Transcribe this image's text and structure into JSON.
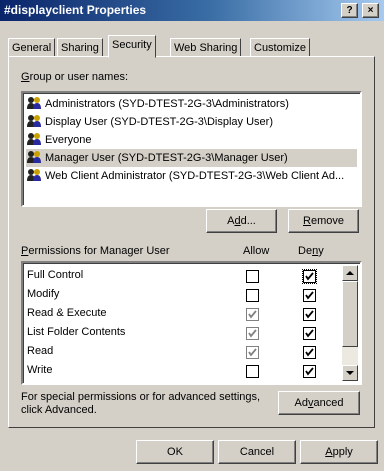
{
  "window": {
    "title": "#displayclient Properties",
    "help_label": "?",
    "close_label": "×"
  },
  "tabs": [
    {
      "label": "General"
    },
    {
      "label": "Sharing"
    },
    {
      "label": "Security"
    },
    {
      "label": "Web Sharing"
    },
    {
      "label": "Customize"
    }
  ],
  "group_section": {
    "label_first": "G",
    "label_rest": "roup or user names:",
    "items": [
      {
        "label": "Administrators (SYD-DTEST-2G-3\\Administrators)"
      },
      {
        "label": "Display User (SYD-DTEST-2G-3\\Display User)"
      },
      {
        "label": "Everyone"
      },
      {
        "label": "Manager User (SYD-DTEST-2G-3\\Manager User)"
      },
      {
        "label": "Web Client Administrator (SYD-DTEST-2G-3\\Web Client Ad..."
      }
    ],
    "selected_index": 3,
    "add_before": "A",
    "add_u": "d",
    "add_after": "d...",
    "remove_u": "R",
    "remove_rest": "emove"
  },
  "permissions": {
    "label_first": "P",
    "label_rest": "ermissions for Manager User",
    "allow_header": "Allow",
    "deny_header_before": "De",
    "deny_header_u": "n",
    "deny_header_after": "y",
    "rows": [
      {
        "name": "Full Control",
        "allow": "unchecked",
        "deny": "checked"
      },
      {
        "name": "Modify",
        "allow": "unchecked",
        "deny": "checked"
      },
      {
        "name": "Read & Execute",
        "allow": "grey-checked",
        "deny": "checked"
      },
      {
        "name": "List Folder Contents",
        "allow": "grey-checked",
        "deny": "checked"
      },
      {
        "name": "Read",
        "allow": "grey-checked",
        "deny": "checked"
      },
      {
        "name": "Write",
        "allow": "unchecked",
        "deny": "checked"
      }
    ]
  },
  "advanced": {
    "text_line1": "For special permissions or for advanced settings,",
    "text_line2": "click Advanced.",
    "button_before": "Ad",
    "button_u": "v",
    "button_after": "anced"
  },
  "footer": {
    "ok_label": "OK",
    "cancel_label": "Cancel",
    "apply_u": "A",
    "apply_rest": "pply"
  }
}
